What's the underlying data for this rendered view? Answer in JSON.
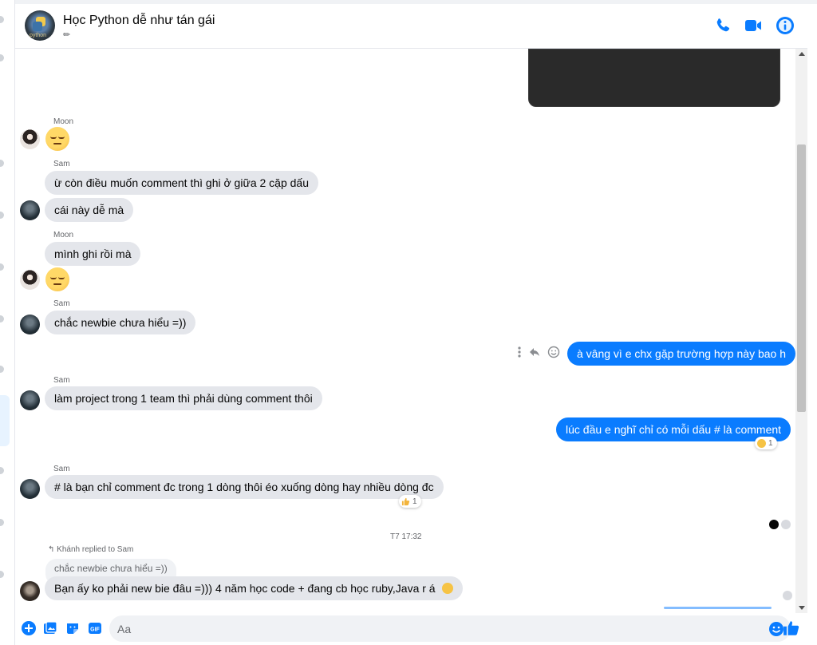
{
  "header": {
    "title": "Học Python dễ như tán gái",
    "subtitle": "✏",
    "avatar_text": "python"
  },
  "colors": {
    "accent": "#0a7cff",
    "incoming_bubble": "#e4e6eb",
    "secondary_text": "#65676b"
  },
  "messages": {
    "m1": {
      "sender": "Moon"
    },
    "m2": {
      "sender": "Sam",
      "text_a": "ừ còn điều muốn comment thì ghi ở giữa 2 cặp dấu",
      "text_b": "cái này dễ mà"
    },
    "m3": {
      "sender": "Moon",
      "text": "mình ghi rồi mà"
    },
    "m4": {
      "sender": "Sam",
      "text": "chắc newbie chưa hiểu =))"
    },
    "m5": {
      "text": "à vâng vì e chx gặp trường hợp này bao h"
    },
    "m6": {
      "sender": "Sam",
      "text": "làm project trong 1 team thì phải dùng comment thôi"
    },
    "m7": {
      "text": "lúc đầu e nghĩ chỉ có mỗi dấu # là comment",
      "reaction_count": "1"
    },
    "m8": {
      "sender": "Sam",
      "text": "# là bạn chỉ comment đc trong 1 dòng thôi éo xuống dòng hay nhiều dòng đc",
      "reaction_count": "1"
    },
    "timestamp": "T7 17:32",
    "m9": {
      "reply_meta": "Khánh replied to Sam",
      "quote": "chắc newbie chưa hiểu =))",
      "text": "Bạn ấy ko phải new bie đâu =))) 4 năm học code + đang cb học ruby,Java r á"
    }
  },
  "composer": {
    "placeholder": "Aa"
  }
}
